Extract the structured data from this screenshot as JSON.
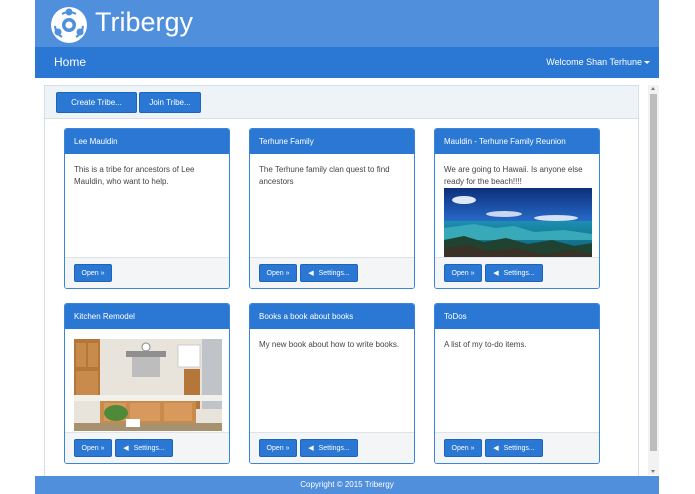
{
  "brand": {
    "name": "Tribergy",
    "logo_icon": "people-network-icon"
  },
  "nav": {
    "home": "Home",
    "welcome": "Welcome Shan Terhune"
  },
  "toolbar": {
    "create": "Create Tribe...",
    "join": "Join Tribe..."
  },
  "cards": [
    {
      "title": "Lee Mauldin",
      "text": "This is a tribe for ancestors of Lee Mauldin, who want to help.",
      "image": "",
      "buttons": {
        "open": "Open »"
      }
    },
    {
      "title": "Terhune Family",
      "text": "The Terhune family clan quest to find ancestors",
      "image": "",
      "buttons": {
        "open": "Open »",
        "settings": "Settings..."
      }
    },
    {
      "title": "Mauldin - Terhune Family Reunion",
      "text": "We are going to Hawaii. Is anyone else ready for the beach!!!!",
      "image": "beach-photo",
      "buttons": {
        "open": "Open »",
        "settings": "Settings..."
      }
    },
    {
      "title": "Kitchen Remodel",
      "text": "",
      "image": "kitchen-photo",
      "buttons": {
        "open": "Open »",
        "settings": "Settings..."
      }
    },
    {
      "title": "Books a book about books",
      "text": "My new book about how to write books.",
      "image": "",
      "buttons": {
        "open": "Open »",
        "settings": "Settings..."
      }
    },
    {
      "title": "ToDos",
      "text": "A list of my to-do items.",
      "image": "",
      "buttons": {
        "open": "Open »",
        "settings": "Settings..."
      }
    }
  ],
  "footer": "Copyright © 2015 Tribergy",
  "colors": {
    "brand_bar": "#4f8fdb",
    "navbar": "#2a78d3",
    "accent": "#2a78d3",
    "card_border": "#3a85da"
  }
}
